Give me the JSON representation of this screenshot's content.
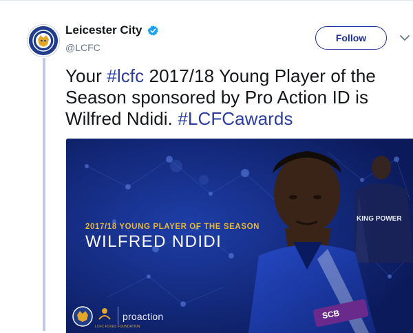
{
  "tweet": {
    "author_name": "Leicester City",
    "handle": "@LCFC",
    "follow_label": "Follow",
    "text_segments": [
      {
        "text": "Your ",
        "type": "text"
      },
      {
        "text": "#lcfc",
        "type": "hashtag"
      },
      {
        "text": " 2017/18 Young Player of the Season sponsored by Pro Action ID is Wilfred Ndidi. ",
        "type": "text"
      },
      {
        "text": "#LCFCawards",
        "type": "hashtag"
      }
    ]
  },
  "media": {
    "award_title": "2017/18 YOUNG PLAYER OF THE SEASON",
    "player_name": "WILFRED NDIDI",
    "sponsor_logo_text": "proaction",
    "foundation_text": "LCFC FOXES FOUNDATION",
    "kit_text": "KING POWER",
    "shirt_sponsor": "SCB"
  },
  "colors": {
    "brand_blue": "#1d2f8f",
    "hashtag": "#2b3ea0",
    "media_bg": "#10246e",
    "gold": "#e8b83a",
    "thread_line": "#c4c7e6",
    "verified": "#1da1f2"
  },
  "icons": [
    "club-crest-icon",
    "verified-badge-icon",
    "chevron-down-icon"
  ]
}
